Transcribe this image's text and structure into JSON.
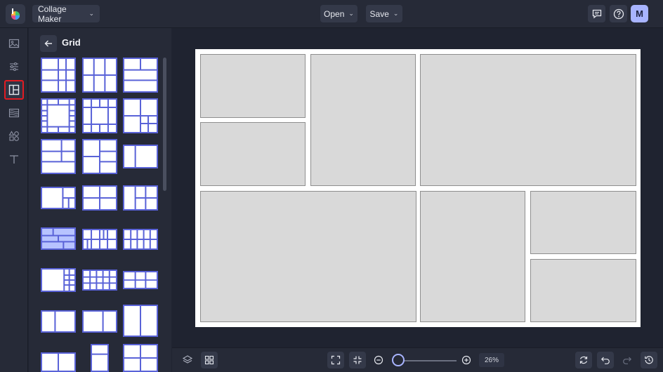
{
  "topbar": {
    "app_menu_label": "Collage Maker",
    "open_label": "Open",
    "save_label": "Save",
    "avatar_initial": "M"
  },
  "rail": {
    "items": [
      {
        "icon": "image-icon"
      },
      {
        "icon": "sliders-icon"
      },
      {
        "icon": "layout-icon",
        "active": true
      },
      {
        "icon": "texture-icon"
      },
      {
        "icon": "shapes-icon"
      },
      {
        "icon": "text-icon"
      }
    ]
  },
  "panel": {
    "title": "Grid",
    "selected_layout_index": 12
  },
  "bottombar": {
    "zoom_value": "26%"
  },
  "colors": {
    "accent": "#a8b4ff",
    "grid_line": "#5a63d8",
    "active_highlight": "#e11b22",
    "selected_layout_fill": "#b7c3ff"
  }
}
